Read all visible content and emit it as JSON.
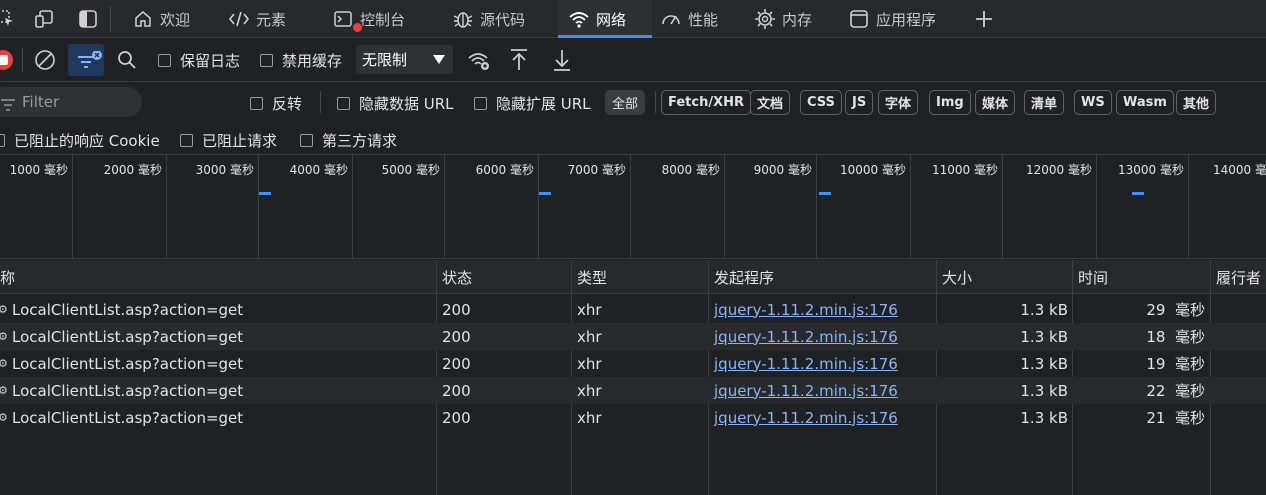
{
  "tabs": [
    {
      "label": "欢迎",
      "icon": "home-icon"
    },
    {
      "label": "元素",
      "icon": "code-icon"
    },
    {
      "label": "控制台",
      "icon": "console-icon"
    },
    {
      "label": "源代码",
      "icon": "bug-icon"
    },
    {
      "label": "网络",
      "icon": "wifi-icon",
      "active": true
    },
    {
      "label": "性能",
      "icon": "gauge-icon"
    },
    {
      "label": "内存",
      "icon": "chip-icon"
    },
    {
      "label": "应用程序",
      "icon": "app-icon"
    }
  ],
  "toolbar": {
    "preserve_log": "保留日志",
    "disable_cache": "禁用缓存",
    "throttle_value": "无限制"
  },
  "filter": {
    "placeholder": "Filter",
    "invert": "反转",
    "hide_data_url": "隐藏数据 URL",
    "hide_ext_url": "隐藏扩展 URL",
    "types": [
      "全部",
      "Fetch/XHR",
      "文档",
      "CSS",
      "JS",
      "字体",
      "Img",
      "媒体",
      "清单",
      "WS",
      "Wasm",
      "其他"
    ]
  },
  "row3": {
    "blocked_cookies": "已阻止的响应 Cookie",
    "blocked_requests": "已阻止请求",
    "third_party": "第三方请求"
  },
  "overview": {
    "ticks": [
      "1000 毫秒",
      "2000 毫秒",
      "3000 毫秒",
      "4000 毫秒",
      "5000 毫秒",
      "6000 毫秒",
      "7000 毫秒",
      "8000 毫秒",
      "9000 毫秒",
      "10000 毫秒",
      "11000 毫秒",
      "12000 毫秒",
      "13000 毫秒",
      "14000 毫秒"
    ]
  },
  "table": {
    "headers": [
      "称",
      "状态",
      "类型",
      "发起程序",
      "大小",
      "时间",
      "履行者"
    ],
    "rows": [
      {
        "name": "LocalClientList.asp?action=get",
        "status": "200",
        "type": "xhr",
        "initiator": "jquery-1.11.2.min.js:176",
        "size": "1.3 kB",
        "time": "29",
        "unit": "毫秒"
      },
      {
        "name": "LocalClientList.asp?action=get",
        "status": "200",
        "type": "xhr",
        "initiator": "jquery-1.11.2.min.js:176",
        "size": "1.3 kB",
        "time": "18",
        "unit": "毫秒"
      },
      {
        "name": "LocalClientList.asp?action=get",
        "status": "200",
        "type": "xhr",
        "initiator": "jquery-1.11.2.min.js:176",
        "size": "1.3 kB",
        "time": "19",
        "unit": "毫秒"
      },
      {
        "name": "LocalClientList.asp?action=get",
        "status": "200",
        "type": "xhr",
        "initiator": "jquery-1.11.2.min.js:176",
        "size": "1.3 kB",
        "time": "22",
        "unit": "毫秒"
      },
      {
        "name": "LocalClientList.asp?action=get",
        "status": "200",
        "type": "xhr",
        "initiator": "jquery-1.11.2.min.js:176",
        "size": "1.3 kB",
        "time": "21",
        "unit": "毫秒"
      }
    ]
  },
  "colors": {
    "accent": "#3d8eff",
    "record": "#e84040",
    "link": "#8ab4f8"
  }
}
